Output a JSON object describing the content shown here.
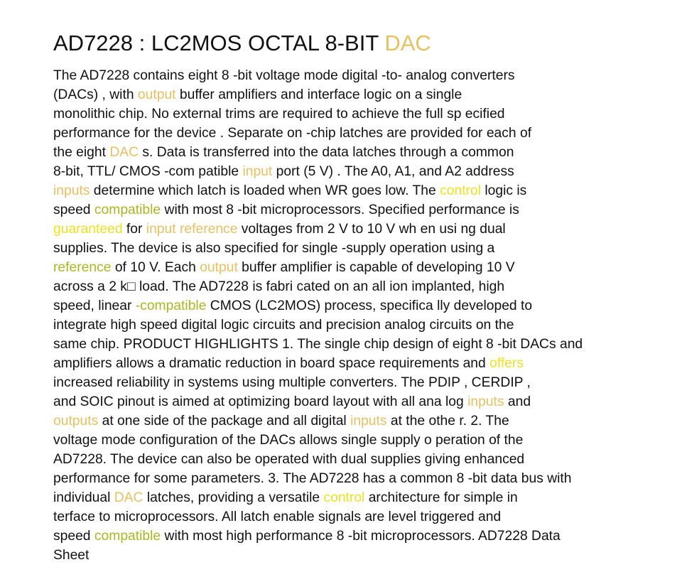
{
  "title": {
    "text": "AD7228 : LC2MOS OCTAL 8-BIT ",
    "highlight": "DAC"
  },
  "colors": {
    "text": "#111111",
    "orange": "#e8c060",
    "olive": "#a8b820",
    "yellow": "#f0e020"
  },
  "lines": [
    [
      {
        "t": "The AD7228 contains eight 8 -bit voltage mode digital -to- analog converters"
      }
    ],
    [
      {
        "t": "(DACs) , with "
      },
      {
        "t": "output",
        "c": "orange"
      },
      {
        "t": " buffer amplifiers and interface logic on a single"
      }
    ],
    [
      {
        "t": "monolithic chip. No external trims are required to achieve the full sp ecified"
      }
    ],
    [
      {
        "t": "performance for the device . Separate on -chip latches are provided for each of"
      }
    ],
    [
      {
        "t": "the eight "
      },
      {
        "t": "DAC",
        "c": "orange"
      },
      {
        "t": " s. Data is transferred into the data latches through a common"
      }
    ],
    [
      {
        "t": "8-bit, TTL/ CMOS -com patible "
      },
      {
        "t": "input",
        "c": "orange"
      },
      {
        "t": " port (5 V) . The A0, A1, and A2 address"
      }
    ],
    [
      {
        "t": "inputs",
        "c": "orange"
      },
      {
        "t": " determine which latch is loaded when WR goes low. The "
      },
      {
        "t": "control",
        "c": "yellow"
      },
      {
        "t": " logic is"
      }
    ],
    [
      {
        "t": "speed "
      },
      {
        "t": "compatible",
        "c": "olive"
      },
      {
        "t": " with most 8 -bit microprocessors. Specified performance is"
      }
    ],
    [
      {
        "t": "guaranteed",
        "c": "yellow"
      },
      {
        "t": " for "
      },
      {
        "t": "input reference",
        "c": "orange"
      },
      {
        "t": " voltages from 2 V to 10 V wh en usi ng dual"
      }
    ],
    [
      {
        "t": "supplies. The device is also specified for single -supply operation using a"
      }
    ],
    [
      {
        "t": "reference",
        "c": "olive"
      },
      {
        "t": " of 10 V. Each "
      },
      {
        "t": "output",
        "c": "orange"
      },
      {
        "t": " buffer amplifier is capable of developing 10 V"
      }
    ],
    [
      {
        "t": "across a 2 k□    load. The AD7228 is fabri cated on an all ion implanted, high"
      }
    ],
    [
      {
        "t": "speed, linear "
      },
      {
        "t": "-compatible",
        "c": "olive"
      },
      {
        "t": " CMOS (LC2MOS) process, specifica lly developed to"
      }
    ],
    [
      {
        "t": "integrate high speed digital logic circuits and precision analog circuits on the"
      }
    ],
    [
      {
        "t": "same chip. PRODUCT HIGHLIGHTS 1. The single chip design of eight 8 -bit DACs and"
      }
    ],
    [
      {
        "t": "amplifiers allows a dramatic reduction in board space requirements and "
      },
      {
        "t": "offers",
        "c": "yellow"
      }
    ],
    [
      {
        "t": "increased reliability in systems using multiple converters. The PDIP , CERDIP ,"
      }
    ],
    [
      {
        "t": "and SOIC pinout is aimed at optimizing board layout with all ana log "
      },
      {
        "t": "inputs",
        "c": "orange"
      },
      {
        "t": " and"
      }
    ],
    [
      {
        "t": "outputs",
        "c": "orange"
      },
      {
        "t": " at one side of the package and all digital "
      },
      {
        "t": "inputs",
        "c": "orange"
      },
      {
        "t": " at the othe r. 2. The"
      }
    ],
    [
      {
        "t": "voltage mode configuration of the DACs allows single supply o peration of the"
      }
    ],
    [
      {
        "t": "AD7228. The device can also be operated with dual supplies giving enhanced"
      }
    ],
    [
      {
        "t": "performance for some parameters. 3. The AD7228 has a common 8 -bit data bus with"
      }
    ],
    [
      {
        "t": "individual "
      },
      {
        "t": "DAC",
        "c": "orange"
      },
      {
        "t": " latches, providing a versatile "
      },
      {
        "t": "control",
        "c": "yellow"
      },
      {
        "t": " architecture for simple in"
      }
    ],
    [
      {
        "t": "terface to microprocessors. All latch enable signals are level triggered and"
      }
    ],
    [
      {
        "t": "speed "
      },
      {
        "t": "compatible",
        "c": "olive"
      },
      {
        "t": " with most high performance 8 -bit microprocessors. AD7228 Data"
      }
    ],
    [
      {
        "t": "Sheet"
      }
    ]
  ]
}
